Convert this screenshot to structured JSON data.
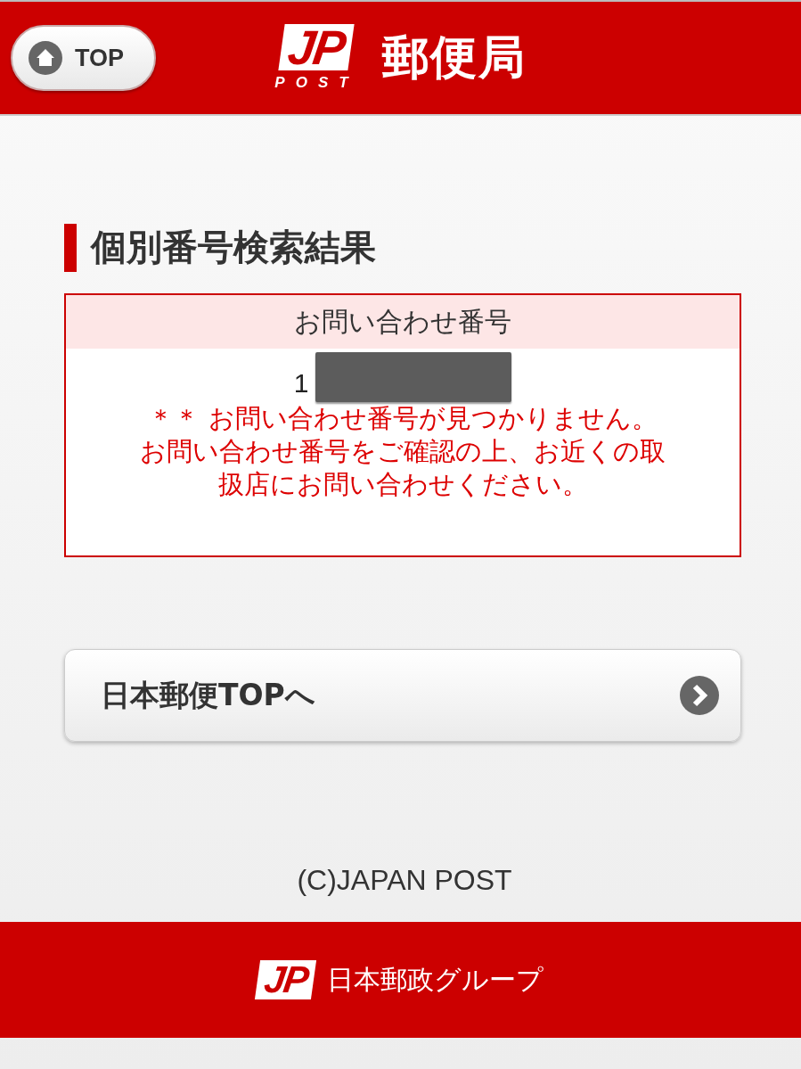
{
  "header": {
    "top_button": "TOP",
    "logo_letters": "JP",
    "logo_sub": "POST",
    "site_name": "郵便局"
  },
  "section": {
    "heading": "個別番号検索結果"
  },
  "result": {
    "column_header": "お問い合わせ番号",
    "number": "1",
    "redacted": true,
    "error_lines": [
      "＊＊ お問い合わせ番号が見つかりません。",
      "お問い合わせ番号をご確認の上、お近くの取",
      "扱店にお問い合わせください。"
    ]
  },
  "nav_button": {
    "label": "日本郵便TOPへ"
  },
  "copyright": "(C)JAPAN POST",
  "footer": {
    "logo_letters": "JP",
    "group_name": "日本郵政グループ"
  }
}
